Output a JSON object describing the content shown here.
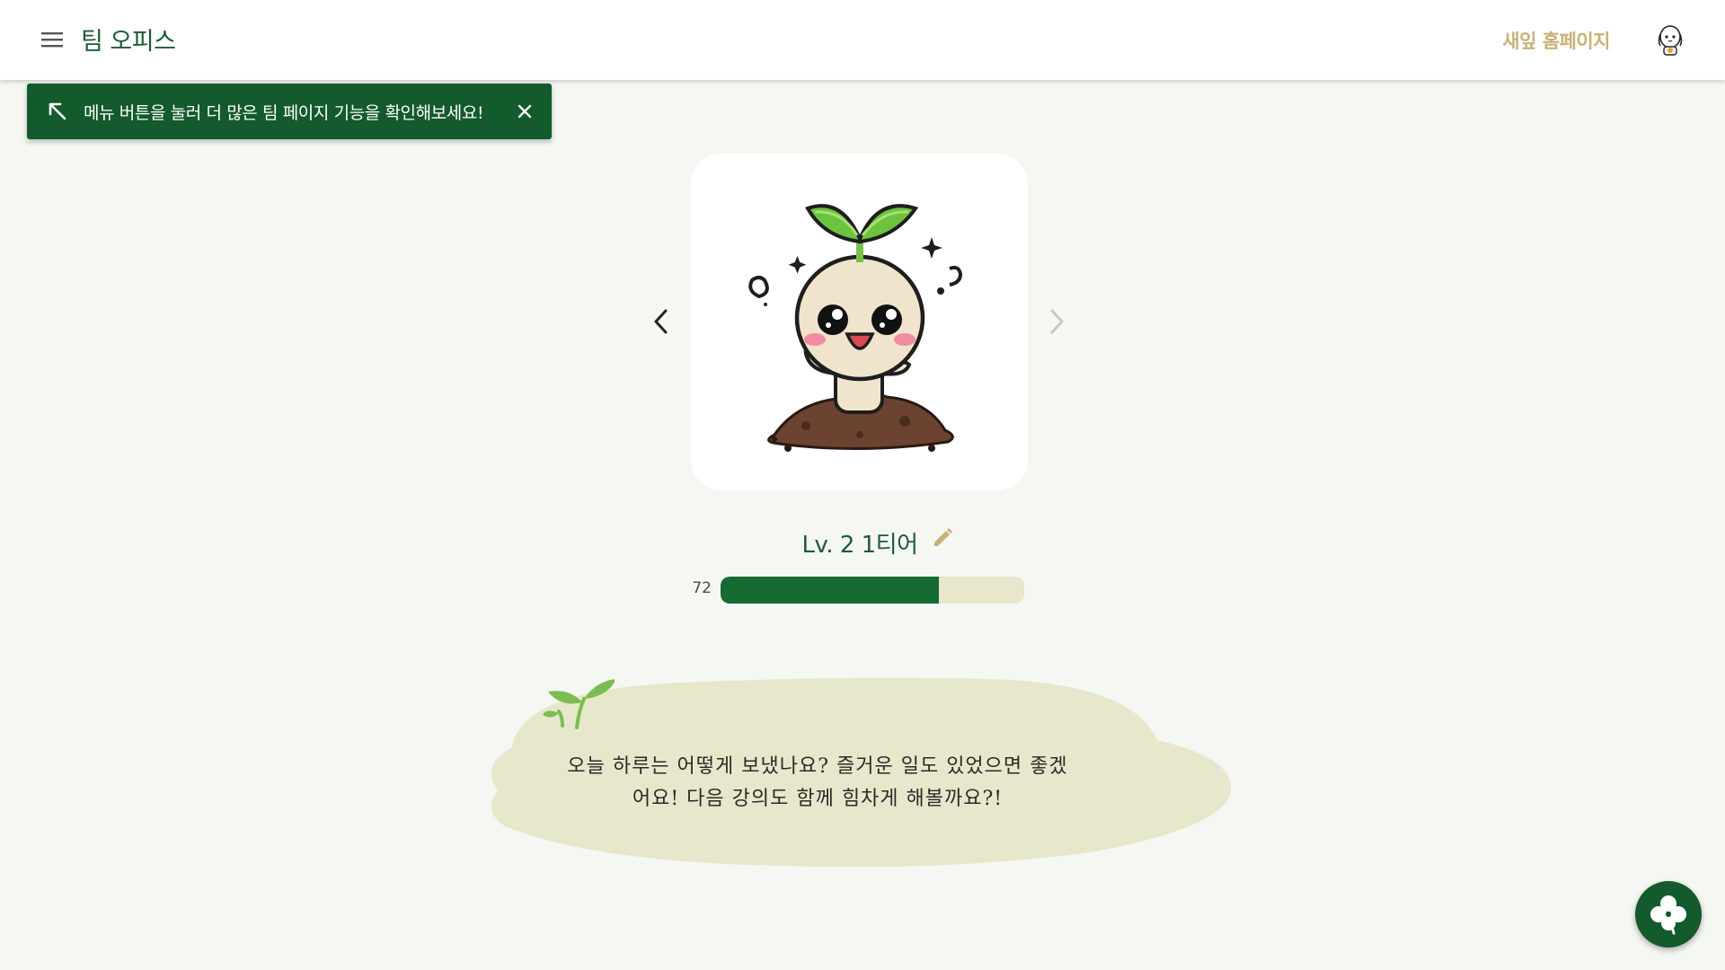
{
  "header": {
    "title": "팀 오피스",
    "new_home_link": "새잎 홈페이지",
    "menu_icon": "hamburger-menu-icon",
    "avatar_icon": "character-avatar-icon"
  },
  "toast": {
    "message": "메뉴 버튼을 눌러 더 많은 팀 페이지 기능을 확인해보세요!",
    "arrow_icon": "arrow-up-left-icon",
    "close_icon": "close-icon"
  },
  "character": {
    "image": "sprout-character-illustration",
    "prev_icon": "chevron-left-icon",
    "next_icon": "chevron-right-icon",
    "next_disabled": true
  },
  "level": {
    "label": "Lv. 2 1티어",
    "edit_icon": "pencil-icon"
  },
  "progress": {
    "value_label": "72",
    "fraction": 0.72
  },
  "message": {
    "line1": "오늘 하루는 어떻게 보냈나요? 즐거운 일도 있었으면 좋겠",
    "line2": "어요! 다음 강의도 함께 힘차게 해볼까요?!",
    "decoration_icon": "sprout-icon"
  },
  "fab": {
    "icon": "clover-icon"
  },
  "colors": {
    "brand_green": "#135a2c",
    "title_green": "#1d5c33",
    "gold_link": "#c9b178",
    "bubble": "#e7e8cb",
    "background": "#f5f7f3"
  }
}
